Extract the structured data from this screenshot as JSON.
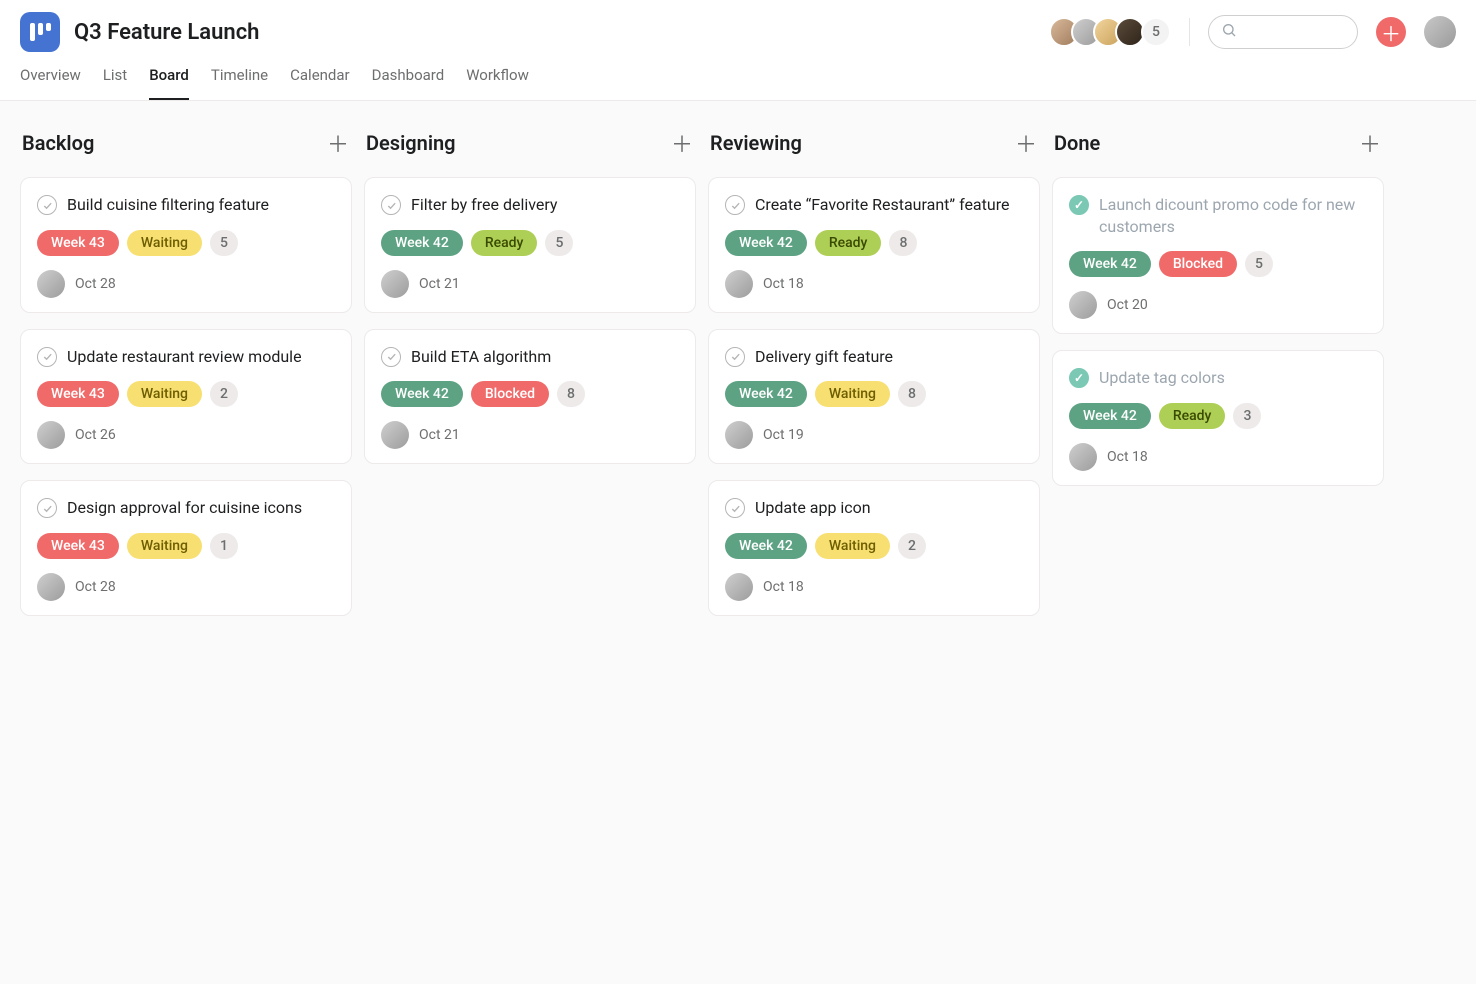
{
  "project": {
    "title": "Q3 Feature Launch"
  },
  "header": {
    "avatar_overflow": "5",
    "search_placeholder": ""
  },
  "tabs": [
    {
      "label": "Overview",
      "active": false
    },
    {
      "label": "List",
      "active": false
    },
    {
      "label": "Board",
      "active": true
    },
    {
      "label": "Timeline",
      "active": false
    },
    {
      "label": "Calendar",
      "active": false
    },
    {
      "label": "Dashboard",
      "active": false
    },
    {
      "label": "Workflow",
      "active": false
    }
  ],
  "columns": [
    {
      "title": "Backlog",
      "cards": [
        {
          "title": "Build cuisine filtering feature",
          "done": false,
          "week": "Week 43",
          "week_kind": "week43",
          "status": "Waiting",
          "status_kind": "waiting",
          "count": "5",
          "date": "Oct 28"
        },
        {
          "title": "Update restaurant review module",
          "done": false,
          "week": "Week 43",
          "week_kind": "week43",
          "status": "Waiting",
          "status_kind": "waiting",
          "count": "2",
          "date": "Oct 26"
        },
        {
          "title": "Design approval for cuisine icons",
          "done": false,
          "week": "Week 43",
          "week_kind": "week43",
          "status": "Waiting",
          "status_kind": "waiting",
          "count": "1",
          "date": "Oct 28"
        }
      ]
    },
    {
      "title": "Designing",
      "cards": [
        {
          "title": "Filter by free delivery",
          "done": false,
          "week": "Week 42",
          "week_kind": "week42",
          "status": "Ready",
          "status_kind": "ready",
          "count": "5",
          "date": "Oct 21"
        },
        {
          "title": "Build ETA algorithm",
          "done": false,
          "week": "Week 42",
          "week_kind": "week42",
          "status": "Blocked",
          "status_kind": "blocked",
          "count": "8",
          "date": "Oct 21"
        }
      ]
    },
    {
      "title": "Reviewing",
      "cards": [
        {
          "title": "Create “Favorite Restaurant” feature",
          "done": false,
          "week": "Week 42",
          "week_kind": "week42",
          "status": "Ready",
          "status_kind": "ready",
          "count": "8",
          "date": "Oct 18"
        },
        {
          "title": "Delivery gift feature",
          "done": false,
          "week": "Week 42",
          "week_kind": "week42",
          "status": "Waiting",
          "status_kind": "waiting",
          "count": "8",
          "date": "Oct 19"
        },
        {
          "title": "Update app icon",
          "done": false,
          "week": "Week 42",
          "week_kind": "week42",
          "status": "Waiting",
          "status_kind": "waiting",
          "count": "2",
          "date": "Oct 18"
        }
      ]
    },
    {
      "title": "Done",
      "cards": [
        {
          "title": "Launch dicount promo code for new customers",
          "done": true,
          "week": "Week 42",
          "week_kind": "week42",
          "status": "Blocked",
          "status_kind": "blocked",
          "count": "5",
          "date": "Oct 20"
        },
        {
          "title": "Update tag colors",
          "done": true,
          "week": "Week 42",
          "week_kind": "week42",
          "status": "Ready",
          "status_kind": "ready",
          "count": "3",
          "date": "Oct 18"
        }
      ]
    }
  ]
}
